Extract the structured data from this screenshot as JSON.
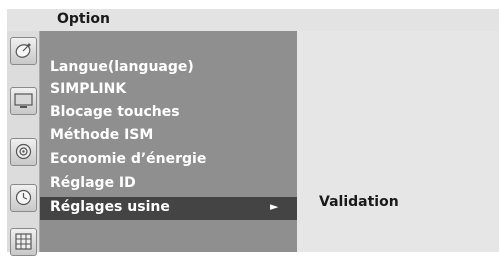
{
  "header": {
    "title": "Option"
  },
  "sidebar_icons": [
    {
      "name": "satellite-dish-icon"
    },
    {
      "name": "tv-screen-icon"
    },
    {
      "name": "speaker-icon"
    },
    {
      "name": "clock-icon"
    },
    {
      "name": "lock-grid-icon"
    }
  ],
  "menu": {
    "items": [
      {
        "label": "Langue(language)"
      },
      {
        "label": "SIMPLINK"
      },
      {
        "label": "Blocage touches"
      },
      {
        "label": "Méthode ISM"
      },
      {
        "label": "Economie d’énergie"
      },
      {
        "label": "Réglage ID"
      },
      {
        "label": "Réglages usine",
        "selected": true,
        "arrow": "►"
      }
    ]
  },
  "submenu": {
    "items": [
      {
        "label": "Validation"
      }
    ]
  },
  "colors": {
    "menu_bg": "#8f8f8f",
    "selected_bg": "#444444",
    "title_bg": "#e3e3e3",
    "submenu_bg": "#e6e6e6"
  }
}
